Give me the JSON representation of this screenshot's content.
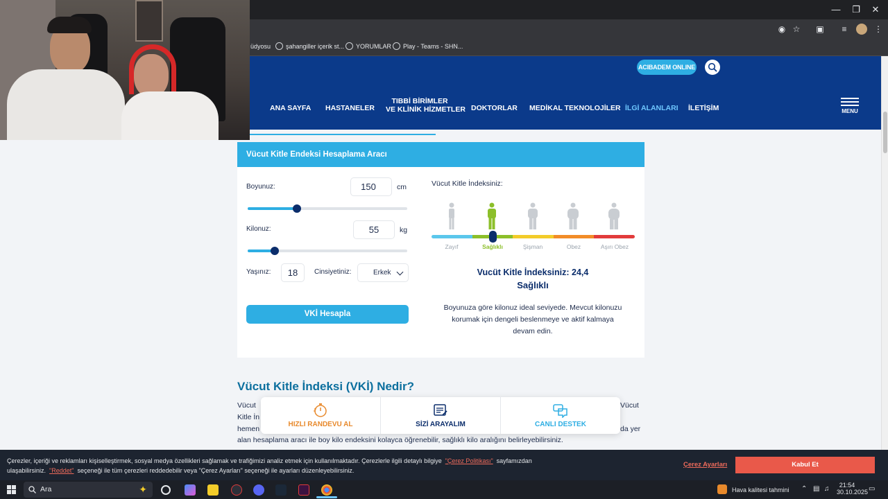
{
  "browser": {
    "bookmarks": [
      "üdyosu",
      "şahangiller içerik st...",
      "YORUMLAR",
      "Play - Teams - SHN..."
    ]
  },
  "site": {
    "online_badge_prefix": "ACIBADEM",
    "online_badge_suffix": "ONLINE",
    "nav": [
      "ANA SAYFA",
      "HASTANELER",
      "TIBBİ BİRİMLER",
      "VE KLİNİK HİZMETLER",
      "DOKTORLAR",
      "MEDİKAL TEKNOLOJİLER",
      "İLGİ ALANLARI",
      "İLETİŞİM"
    ],
    "active_nav": "İLGİ ALANLARI",
    "menu_label": "MENU"
  },
  "calculator": {
    "title": "Vücut Kitle Endeksi Hesaplama Aracı",
    "height_label": "Boyunuz:",
    "height_value": "150",
    "height_unit": "cm",
    "height_slider_fraction": 0.31,
    "weight_label": "Kilonuz:",
    "weight_value": "55",
    "weight_unit": "kg",
    "weight_slider_fraction": 0.17,
    "age_label": "Yaşınız:",
    "age_value": "18",
    "gender_label": "Cinsiyetiniz:",
    "gender_value": "Erkek",
    "button_label": "VKİ Hesapla"
  },
  "result": {
    "heading": "Vücut Kitle İndeksiniz:",
    "categories": [
      "Zayıf",
      "Sağlıklı",
      "Şişman",
      "Obez",
      "Aşırı Obez"
    ],
    "category_colors": [
      "#5bc7ec",
      "#8cbf2a",
      "#f3cc2a",
      "#f28c28",
      "#e23b3b"
    ],
    "active_category": "Sağlıklı",
    "bmi_label": "Vucüt Kitle İndeksiniz:",
    "bmi_value": "24,4",
    "status": "Sağlıklı",
    "advice_lines": [
      "Boyunuza göre kilonuz ideal seviyede. Mevcut kilonuzu",
      "korumak için dengeli beslenmeye ve aktif kalmaya",
      "devam edin."
    ]
  },
  "article": {
    "heading": "Vücut Kitle İndeksi (VKİ) Nedir?",
    "line1_start": "Vücut",
    "line1_end": "Vücut",
    "line2_start": "Kitle İn",
    "line3_start": "hemen",
    "line3_end": "da yer",
    "line4": "alan hesaplama aracı ile boy kilo endeksini kolayca öğrenebilir, sağlıklı kilo aralığını belirleyebilirsiniz."
  },
  "actions": [
    {
      "label": "HIZLI RANDEVU AL",
      "color": "#e8892b"
    },
    {
      "label": "SİZİ ARAYALIM",
      "color": "#0b2d6b"
    },
    {
      "label": "CANLI DESTEK",
      "color": "#2eaee3"
    }
  ],
  "cookie": {
    "text_a": "Çerezler, içeriği ve reklamları kişiselleştirmek, sosyal medya özellikleri sağlamak ve trafiğimizi analiz etmek için kullanılmaktadır. Çerezlerle ilgili detaylı bilgiye",
    "link_policy": "\"Çerez Politikası\"",
    "text_b": "sayfamızdan",
    "text_c": "ulaşabilirsiniz.",
    "link_reject": "\"Reddet\"",
    "text_d": "seçeneği ile tüm çerezleri reddedebilir veya \"Çerez Ayarları\" seçeneği ile ayarları düzenleyebilirsiniz.",
    "settings_label": "Çerez Ayarları",
    "accept_label": "Kabul Et"
  },
  "taskbar": {
    "search_placeholder": "Ara",
    "weather": "Hava kalitesi tahmini",
    "time": "21:54",
    "date": "30.10.2025"
  }
}
